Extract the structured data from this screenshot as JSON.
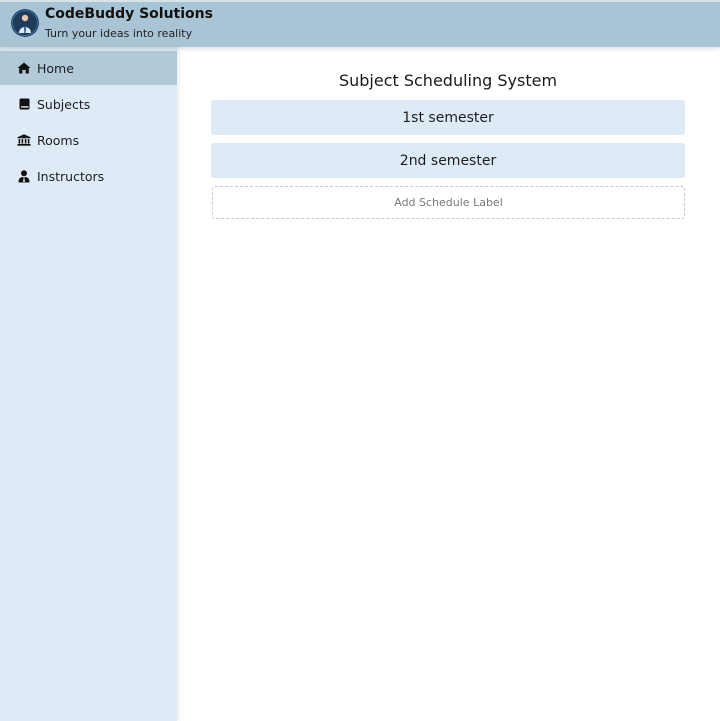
{
  "header": {
    "title": "CodeBuddy Solutions",
    "tagline": "Turn your ideas into reality",
    "logo_icon": "developer-avatar-logo"
  },
  "sidebar": {
    "items": [
      {
        "label": "Home",
        "icon": "home-icon",
        "active": true
      },
      {
        "label": "Subjects",
        "icon": "book-icon",
        "active": false
      },
      {
        "label": "Rooms",
        "icon": "building-icon",
        "active": false
      },
      {
        "label": "Instructors",
        "icon": "user-tie-icon",
        "active": false
      }
    ]
  },
  "main": {
    "title": "Subject Scheduling System",
    "schedules": [
      {
        "label": "1st semester"
      },
      {
        "label": "2nd semester"
      }
    ],
    "add_label": "Add Schedule Label"
  },
  "colors": {
    "header_bg": "#a9c5d5",
    "sidebar_bg": "#deeaf5",
    "sidebar_active_bg": "#b2cad8",
    "schedule_item_bg": "#deeaf6"
  }
}
